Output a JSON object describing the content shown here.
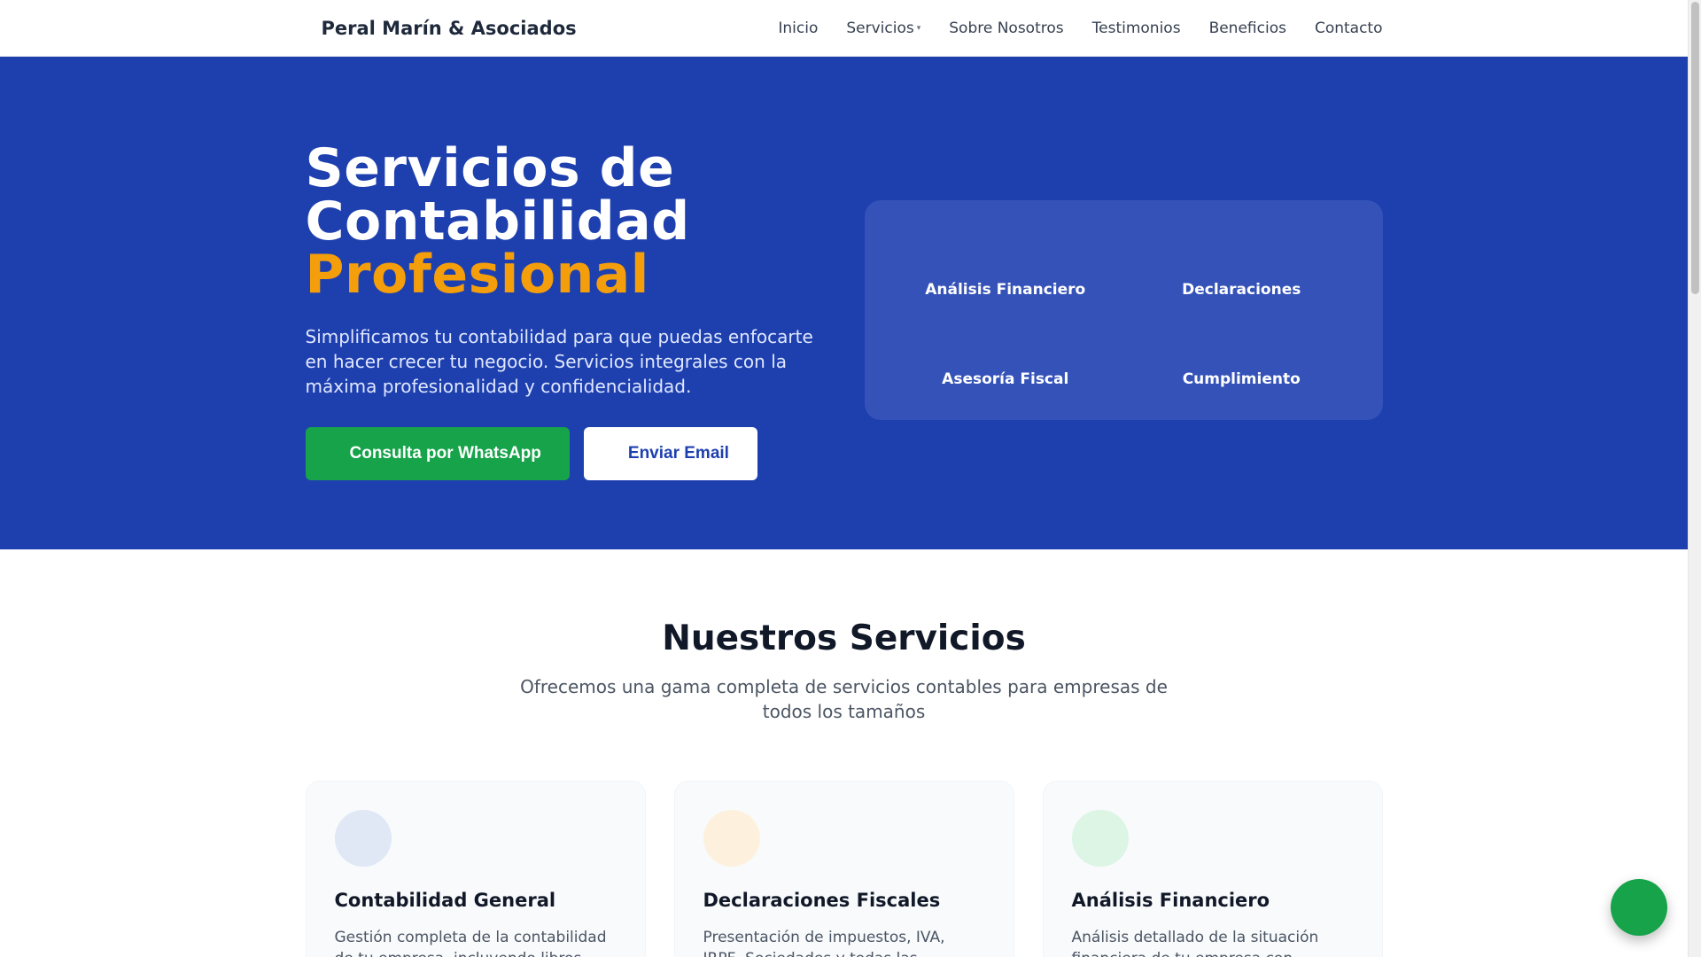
{
  "colors": {
    "primary": "#1e40af",
    "accent": "#f59e0b",
    "whatsapp_green": "#16a34a",
    "hero_card": "#3452b8"
  },
  "nav": {
    "brand_icon": "calculator-icon",
    "brand_icon_glyph": "",
    "brand": "Peral Marín & Asociados",
    "links": [
      {
        "label": "Inicio"
      },
      {
        "label": "Servicios",
        "has_dropdown": true,
        "caret_glyph": "▾"
      },
      {
        "label": "Sobre Nosotros"
      },
      {
        "label": "Testimonios"
      },
      {
        "label": "Beneficios"
      },
      {
        "label": "Contacto"
      }
    ]
  },
  "hero": {
    "title_line1": "Servicios de",
    "title_line2": "Contabilidad",
    "title_accent": "Profesional",
    "description": "Simplificamos tu contabilidad para que puedas enfocarte en hacer crecer tu negocio. Servicios integrales con la máxima profesionalidad y confidencialidad.",
    "buttons": {
      "whatsapp": {
        "icon": "whatsapp-icon",
        "glyph": "",
        "label": "Consulta por WhatsApp"
      },
      "email": {
        "icon": "envelope-icon",
        "glyph": "",
        "label": "Enviar Email"
      }
    },
    "features": [
      {
        "icon": "chart-icon",
        "glyph": "",
        "label": "Análisis Financiero"
      },
      {
        "icon": "document-icon",
        "glyph": "",
        "label": "Declaraciones"
      },
      {
        "icon": "scale-icon",
        "glyph": "",
        "label": "Asesoría Fiscal"
      },
      {
        "icon": "shield-check-icon",
        "glyph": "",
        "label": "Cumplimiento"
      }
    ]
  },
  "services": {
    "title": "Nuestros Servicios",
    "subtitle": "Ofrecemos una gama completa de servicios contables para empresas de todos los tamaños",
    "cards": [
      {
        "icon": "book-icon",
        "glyph": "",
        "icon_bg": "#e0e7f5",
        "icon_color": "#1e40af",
        "title": "Contabilidad General",
        "description": "Gestión completa de la contabilidad de tu empresa, incluyendo libros"
      },
      {
        "icon": "receipt-icon",
        "glyph": "",
        "icon_bg": "#fdf1de",
        "icon_color": "#f59e0b",
        "title": "Declaraciones Fiscales",
        "description": "Presentación de impuestos, IVA, IRPF, Sociedades y todas las obligaciones"
      },
      {
        "icon": "chart-icon",
        "glyph": "",
        "icon_bg": "#dcf5e5",
        "icon_color": "#16a34a",
        "title": "Análisis Financiero",
        "description": "Análisis detallado de la situación financiera de tu empresa con"
      }
    ]
  },
  "floating_button": {
    "icon": "whatsapp-icon",
    "glyph": ""
  }
}
